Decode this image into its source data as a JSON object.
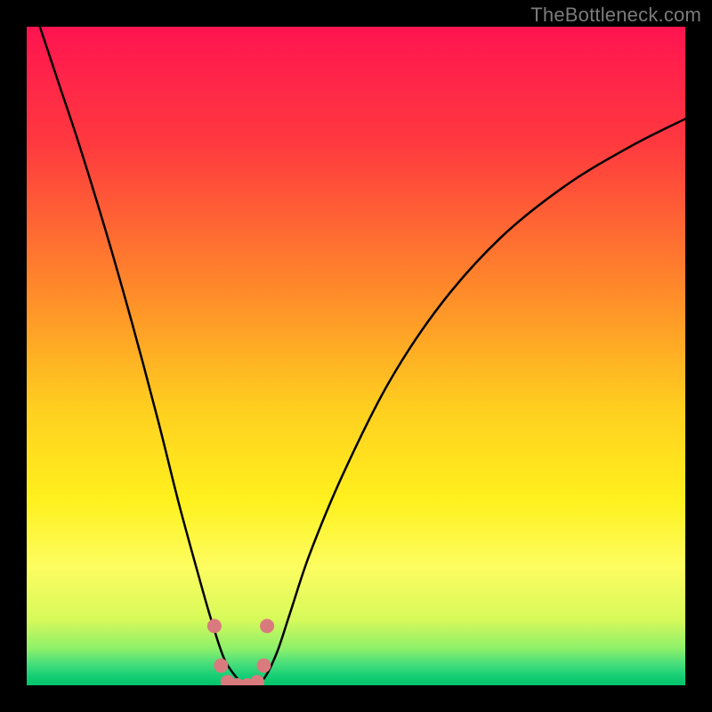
{
  "watermark": "TheBottleneck.com",
  "chart_data": {
    "type": "line",
    "title": "",
    "xlabel": "",
    "ylabel": "",
    "xlim": [
      0,
      100
    ],
    "ylim": [
      0,
      100
    ],
    "grid": false,
    "legend": false,
    "curves": [
      {
        "name": "bottleneck-curve",
        "x": [
          2,
          5,
          8,
          12,
          16,
          20,
          23,
          26,
          28,
          30,
          32,
          33,
          34,
          36,
          38,
          40,
          43,
          48,
          55,
          63,
          72,
          82,
          92,
          100
        ],
        "y": [
          100,
          91,
          82,
          69,
          55,
          40,
          28,
          17,
          10,
          4,
          1,
          0,
          0,
          1,
          5,
          11,
          20,
          32,
          46,
          58,
          68,
          76,
          82,
          86
        ]
      }
    ],
    "scatter_points": [
      {
        "x": 28.5,
        "y": 9
      },
      {
        "x": 29.5,
        "y": 3
      },
      {
        "x": 30.5,
        "y": 0.5
      },
      {
        "x": 32,
        "y": 0
      },
      {
        "x": 33.5,
        "y": 0
      },
      {
        "x": 35,
        "y": 0.5
      },
      {
        "x": 36,
        "y": 3
      },
      {
        "x": 36.5,
        "y": 9
      }
    ],
    "gradient_stops": [
      {
        "offset": 0,
        "color": "#ff1450"
      },
      {
        "offset": 0.18,
        "color": "#ff3a3f"
      },
      {
        "offset": 0.4,
        "color": "#ff8a2a"
      },
      {
        "offset": 0.58,
        "color": "#ffcf1f"
      },
      {
        "offset": 0.72,
        "color": "#fff11e"
      },
      {
        "offset": 0.82,
        "color": "#fdfd60"
      },
      {
        "offset": 0.9,
        "color": "#d7f95a"
      },
      {
        "offset": 0.945,
        "color": "#8cf06a"
      },
      {
        "offset": 0.965,
        "color": "#4fe07a"
      },
      {
        "offset": 0.985,
        "color": "#18cf76"
      },
      {
        "offset": 1.0,
        "color": "#00c46a"
      }
    ]
  }
}
